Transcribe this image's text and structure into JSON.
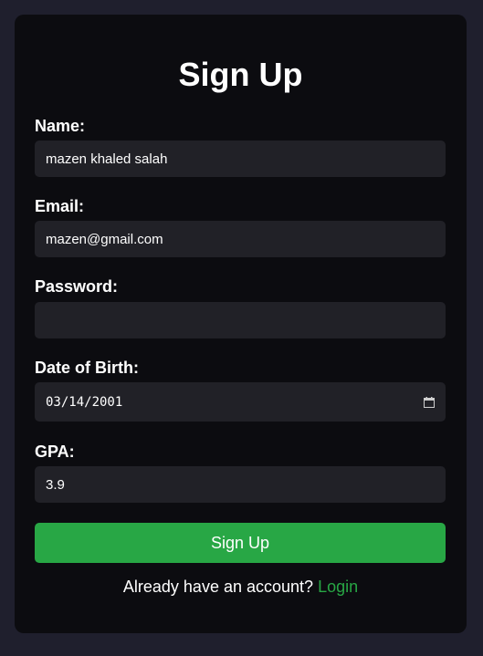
{
  "form": {
    "title": "Sign Up",
    "name_label": "Name:",
    "name_value": "mazen khaled salah",
    "email_label": "Email:",
    "email_value": "mazen@gmail.com",
    "password_label": "Password:",
    "password_value": "",
    "dob_label": "Date of Birth:",
    "dob_value": "03/14/2001",
    "gpa_label": "GPA:",
    "gpa_value": "3.9",
    "submit_label": "Sign Up",
    "footer_text": "Already have an account?",
    "login_link": "Login"
  },
  "colors": {
    "page_bg": "#1f1f2d",
    "card_bg": "#0c0c10",
    "input_bg": "#212127",
    "accent": "#28a745",
    "text": "#ffffff"
  },
  "icons": {
    "date_picker": "calendar-icon"
  }
}
